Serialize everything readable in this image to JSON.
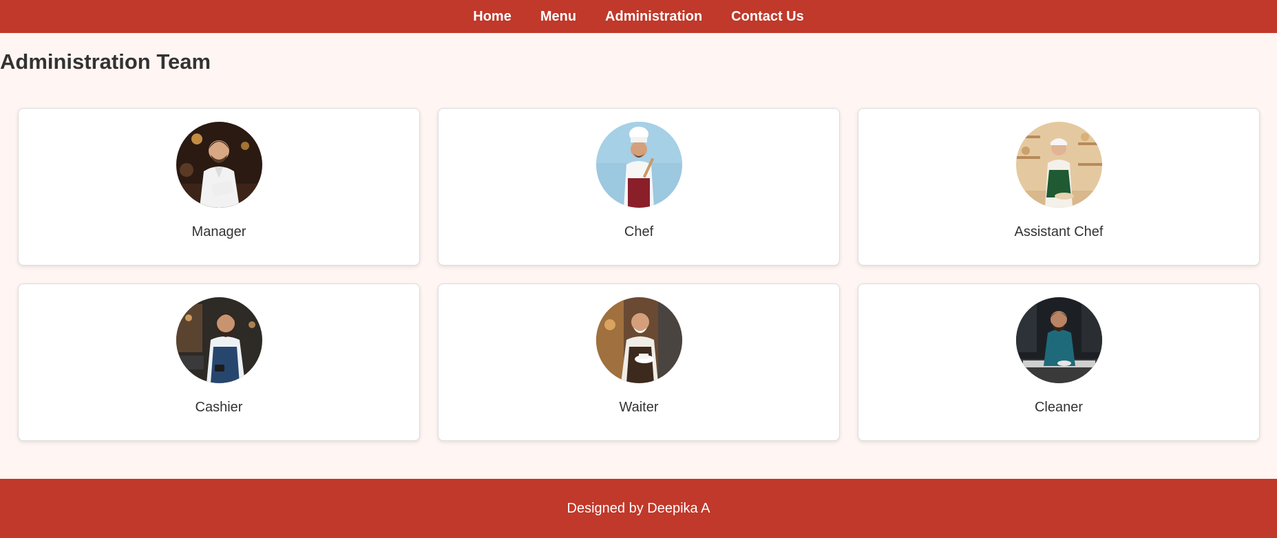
{
  "nav": {
    "home": "Home",
    "menu": "Menu",
    "administration": "Administration",
    "contact": "Contact Us"
  },
  "page": {
    "title": "Administration Team"
  },
  "team": [
    {
      "role": "Manager",
      "photo": "manager-photo"
    },
    {
      "role": "Chef",
      "photo": "chef-photo"
    },
    {
      "role": "Assistant Chef",
      "photo": "assistant-chef-photo"
    },
    {
      "role": "Cashier",
      "photo": "cashier-photo"
    },
    {
      "role": "Waiter",
      "photo": "waiter-photo"
    },
    {
      "role": "Cleaner",
      "photo": "cleaner-photo"
    }
  ],
  "footer": {
    "text": "Designed by Deepika A"
  },
  "colors": {
    "brand": "#c0392b",
    "background": "#fff5f3",
    "card": "#ffffff",
    "text": "#333333"
  }
}
